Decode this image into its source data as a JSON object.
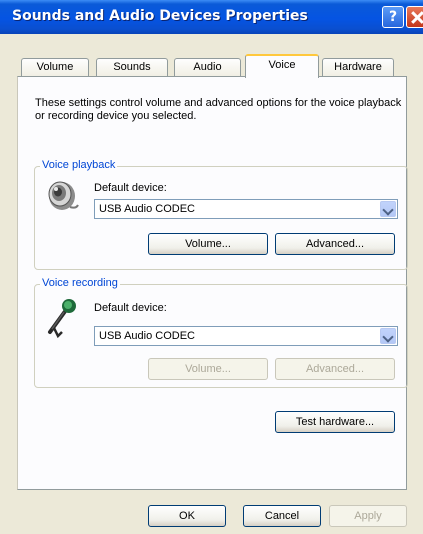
{
  "window": {
    "title": "Sounds and Audio Devices Properties"
  },
  "tabs": [
    {
      "label": "Volume"
    },
    {
      "label": "Sounds"
    },
    {
      "label": "Audio"
    },
    {
      "label": "Voice"
    },
    {
      "label": "Hardware"
    }
  ],
  "active_tab": "Voice",
  "description": "These settings control volume and advanced options for the voice playback or recording device you selected.",
  "playback": {
    "legend": "Voice playback",
    "device_label": "Default device:",
    "device_value": "USB Audio CODEC",
    "volume_label": "Volume...",
    "advanced_label": "Advanced...",
    "icon": "speaker-icon"
  },
  "recording": {
    "legend": "Voice recording",
    "device_label": "Default device:",
    "device_value": "USB Audio CODEC",
    "volume_label": "Volume...",
    "advanced_label": "Advanced...",
    "icon": "microphone-icon"
  },
  "test_hardware_label": "Test hardware...",
  "footer": {
    "ok": "OK",
    "cancel": "Cancel",
    "apply": "Apply"
  },
  "colors": {
    "titlebar": "#0554e3",
    "accent_tab": "#ffc83c",
    "legend": "#0046d5",
    "face": "#ece9d8"
  }
}
